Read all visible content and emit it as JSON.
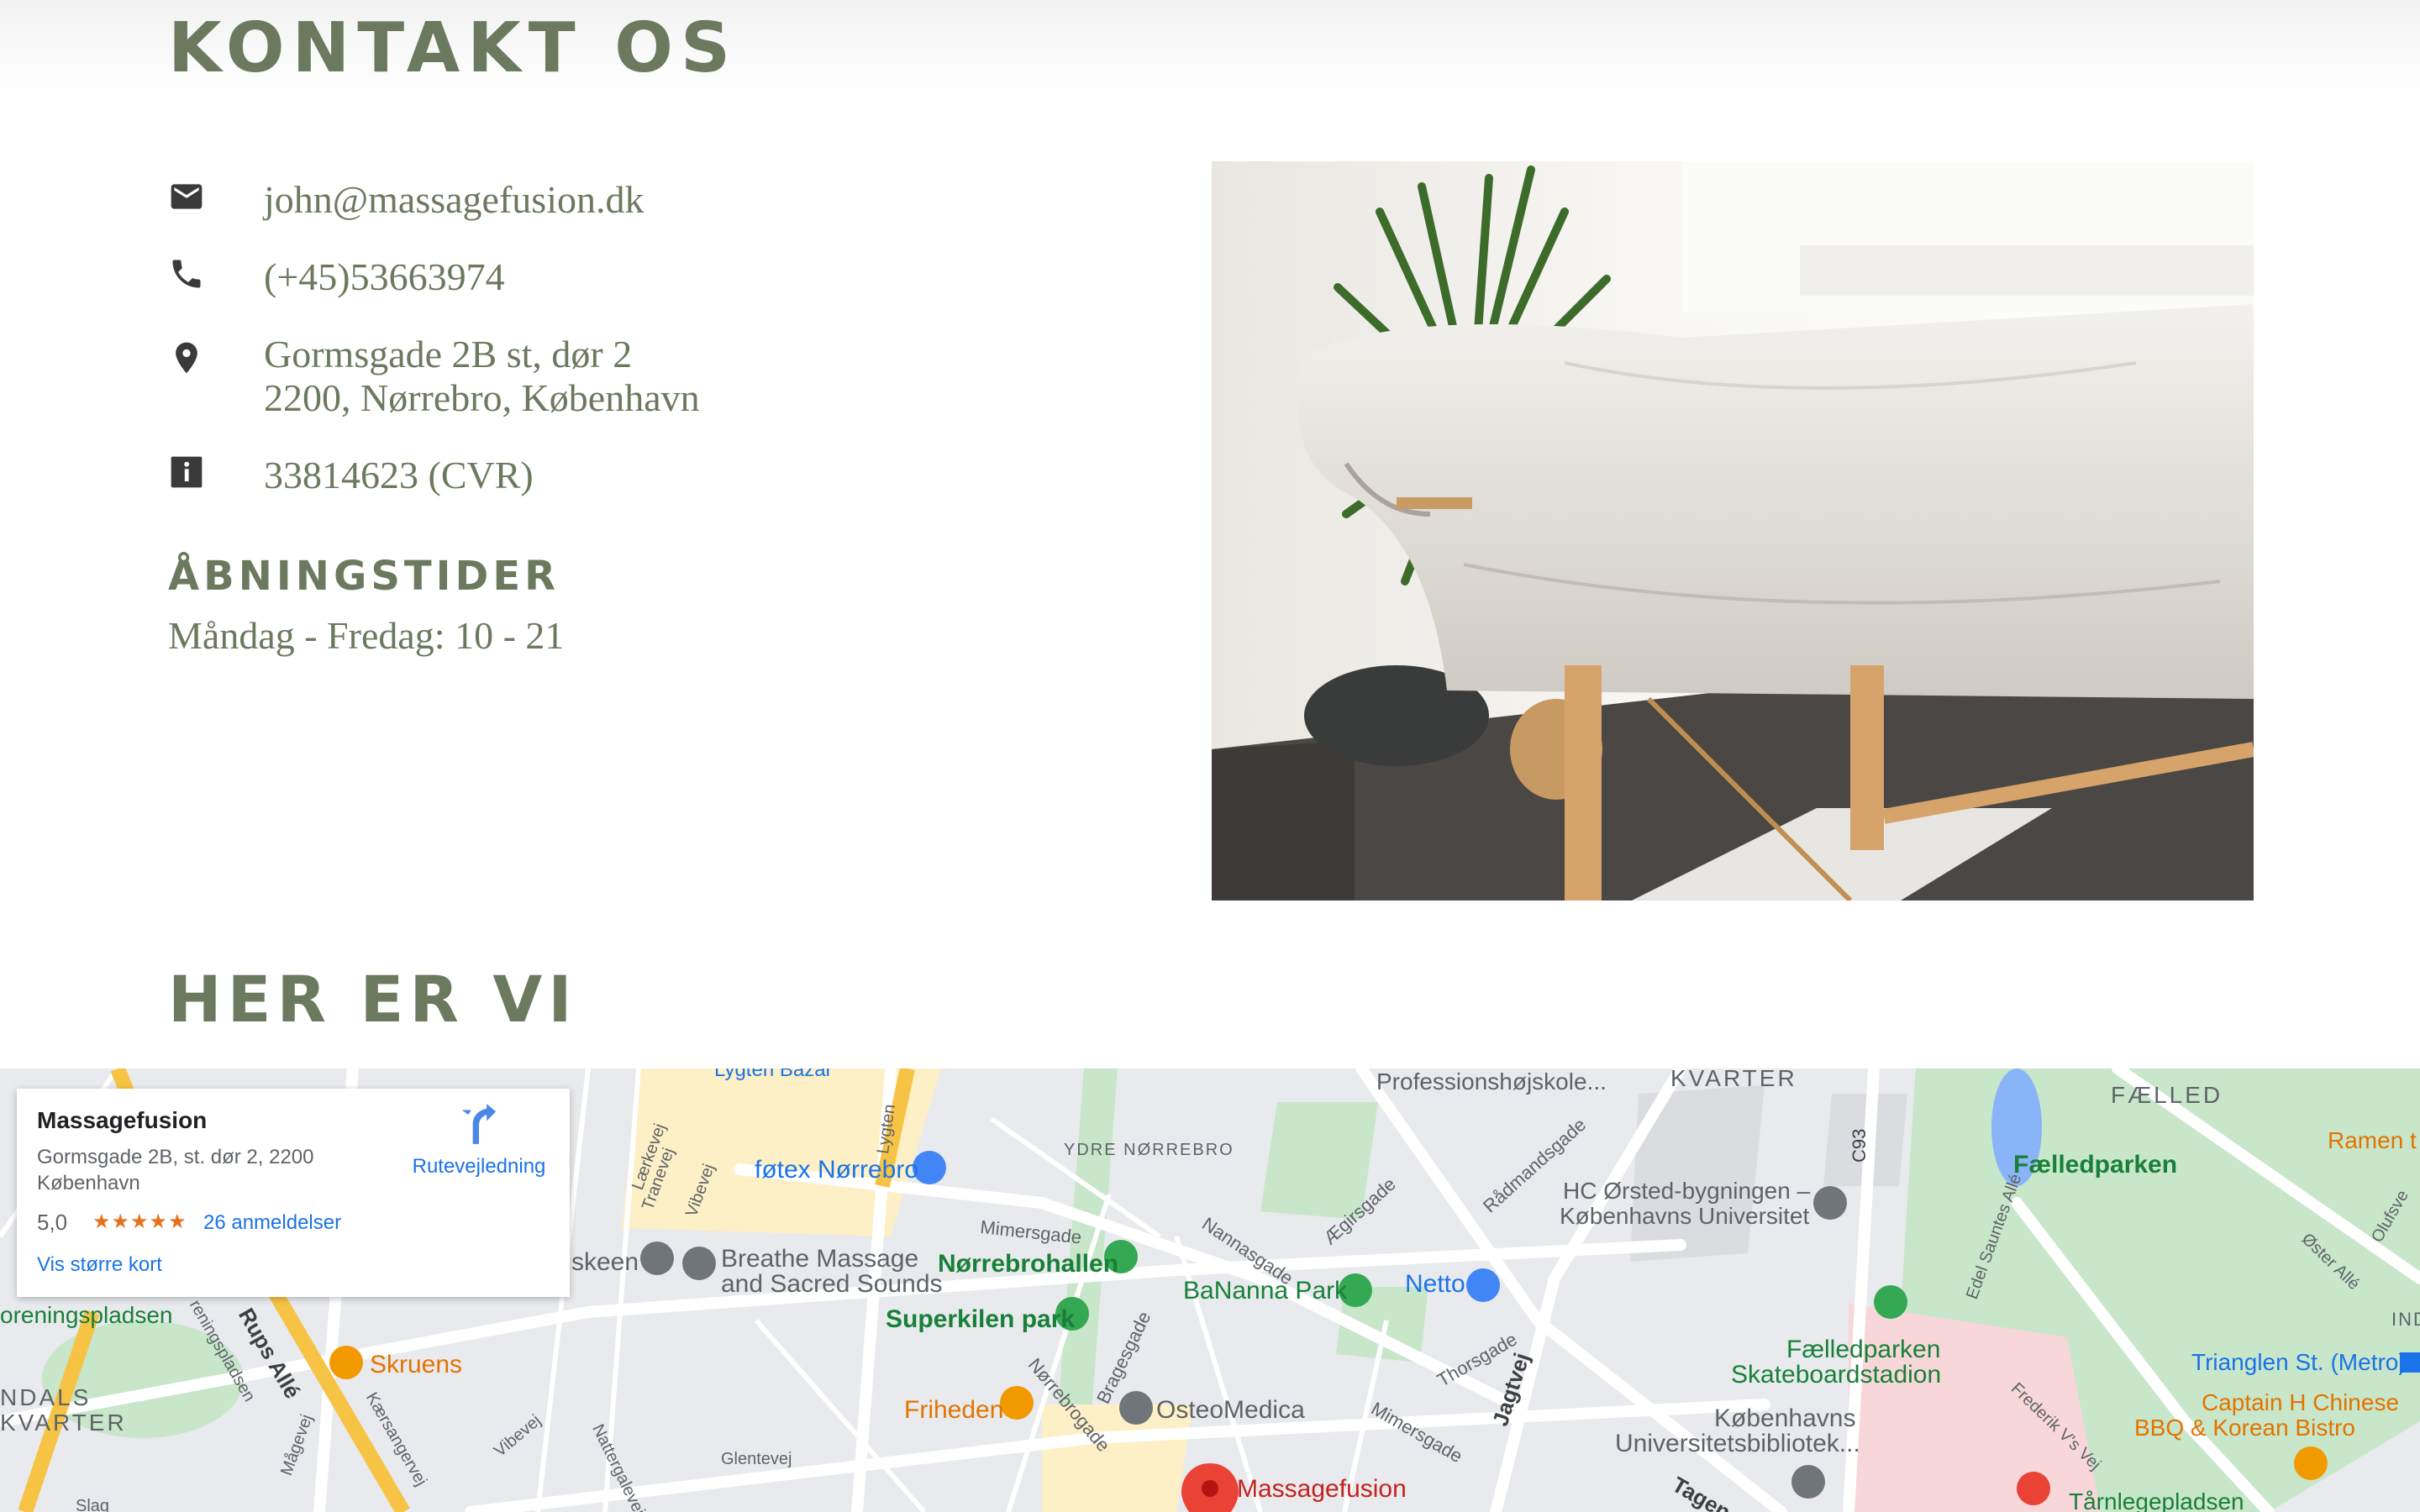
{
  "contact": {
    "title": "KONTAKT OS",
    "email": "john@massagefusion.dk",
    "phone": "(+45)53663974",
    "address_line1": "Gormsgade 2B st, dør 2",
    "address_line2": "2200, Nørrebro, København",
    "cvr": "33814623 (CVR)",
    "icons": [
      "mail-icon",
      "phone-icon",
      "location-pin-icon",
      "info-icon"
    ]
  },
  "hours": {
    "title": "ÅBNINGSTIDER",
    "text": "Måndag - Fredag: 10 - 21"
  },
  "location": {
    "title": "HER ER VI"
  },
  "map_card": {
    "name": "Massagefusion",
    "address": "Gormsgade 2B, st. dør 2, 2200 København",
    "rating": "5,0",
    "stars": "★★★★★",
    "reviews": "26 anmeldelser",
    "view_larger": "Vis større kort",
    "directions": "Rutevejledning"
  },
  "map_labels": {
    "lygten_bazar": "Lygten Bazar",
    "professionshojskole": "Professionshøjskole...",
    "kvarter": "KVARTER",
    "faelled": "FÆLLED",
    "ramen": "Ramen t",
    "faelledparken": "Fælledparken",
    "ydre_norrebro": "YDRE NØRREBRO",
    "fotex": "føtex Nørrebro",
    "hc_orsted": "HC Ørsted-bygningen –",
    "ku": "Københavns Universitet",
    "skeen": "skeen",
    "breathe1": "Breathe Massage",
    "breathe2": "and Sacred Sounds",
    "norrebrohallen": "Nørrebrohallen",
    "banana": "BaNanna Park",
    "netto": "Netto",
    "superkilen": "Superkilen park",
    "skate1": "Fælledparken",
    "skate2": "Skateboardstadion",
    "trianglen": "Trianglen St. (Metro)",
    "captain1": "Captain H Chinese",
    "captain2": "BBQ & Korean Bistro",
    "skruens": "Skruens",
    "ndals": "NDALS",
    "kvarter_left": "KVARTER",
    "oreningspladsen": "oreningspladsen",
    "friheden": "Friheden",
    "osteomedica": "OsteoMedica",
    "bibliotek1": "Københavns",
    "bibliotek2": "Universitetsbibliotek...",
    "massagefusion": "Massagefusion",
    "tarnlege": "Tårnlegepladsen",
    "jagtvej": "Jagtvej",
    "tagens": "Tagens",
    "mimersgade": "Mimersgade",
    "mimersgade2": "Mimersgade",
    "nannasgade": "Nannasgade",
    "aegirsgade": "Ægirsgade",
    "radmandsgade": "Rådmandsgade",
    "thorsgade": "Thorsgade",
    "norrebrogade": "Nørrebrogade",
    "bragesgade": "Bragesgade",
    "glentevej": "Glentevej",
    "c93": "C93",
    "edel": "Edel Sauntes Allé",
    "frederik": "Frederik V's Vej",
    "oster_alle": "Øster Allé",
    "olufsvej": "Olufsve",
    "ind": "IND",
    "laerkevej": "Lærkevej",
    "tranevej": "Tranevej",
    "vibevej": "Vibevej",
    "vibevej2": "Vibevej",
    "lygten": "Lygten",
    "mageevej": "Mågevej",
    "kaersangervej": "Kærsangervej",
    "nattergalevej": "Nattergalevej",
    "rups_alle": "Rups Allé",
    "reningspladsen": "reningspladsen",
    "slagelse": "Slag"
  }
}
